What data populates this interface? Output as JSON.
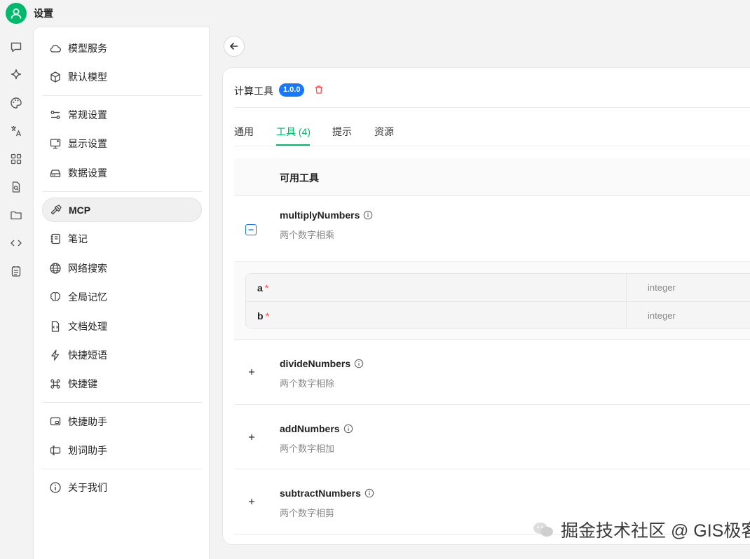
{
  "app": {
    "title": "设置"
  },
  "colors": {
    "accent": "#00b96b",
    "badge": "#1677ff",
    "danger": "#ff4d4f"
  },
  "rail": {
    "icons": [
      "chat-icon",
      "sparkle-icon",
      "palette-icon",
      "translate-icon",
      "apps-grid-icon",
      "file-search-icon",
      "folder-icon",
      "code-icon",
      "notes-icon"
    ]
  },
  "menu": {
    "items": [
      {
        "label": "模型服务",
        "icon": "cloud-icon"
      },
      {
        "label": "默认模型",
        "icon": "cube-icon"
      },
      {
        "label": "常规设置",
        "icon": "sliders-icon"
      },
      {
        "label": "显示设置",
        "icon": "monitor-icon"
      },
      {
        "label": "数据设置",
        "icon": "storage-icon"
      },
      {
        "label": "MCP",
        "icon": "hammer-icon"
      },
      {
        "label": "笔记",
        "icon": "notebook-icon"
      },
      {
        "label": "网络搜索",
        "icon": "globe-icon"
      },
      {
        "label": "全局记忆",
        "icon": "brain-icon"
      },
      {
        "label": "文档处理",
        "icon": "document-code-icon"
      },
      {
        "label": "快捷短语",
        "icon": "bolt-icon"
      },
      {
        "label": "快捷键",
        "icon": "command-icon"
      },
      {
        "label": "快捷助手",
        "icon": "window-assistant-icon"
      },
      {
        "label": "划词助手",
        "icon": "text-select-icon"
      },
      {
        "label": "关于我们",
        "icon": "info-icon"
      }
    ],
    "active": "MCP"
  },
  "server": {
    "name": "计算工具",
    "version": "1.0.0"
  },
  "tabs": [
    {
      "label": "通用"
    },
    {
      "label": "工具 (4)"
    },
    {
      "label": "提示"
    },
    {
      "label": "资源"
    }
  ],
  "active_tab": "工具 (4)",
  "tools": {
    "header": "可用工具",
    "items": [
      {
        "name": "multiplyNumbers",
        "description": "两个数字相乘",
        "expanded": true
      },
      {
        "name": "divideNumbers",
        "description": "两个数字相除",
        "expanded": false
      },
      {
        "name": "addNumbers",
        "description": "两个数字相加",
        "expanded": false
      },
      {
        "name": "subtractNumbers",
        "description": "两个数字相剪",
        "expanded": false
      }
    ],
    "params": [
      {
        "name": "a",
        "required_mark": "*",
        "type": "integer"
      },
      {
        "name": "b",
        "required_mark": "*",
        "type": "integer"
      }
    ]
  },
  "watermark": {
    "text": "掘金技术社区 @ GIS极客"
  }
}
